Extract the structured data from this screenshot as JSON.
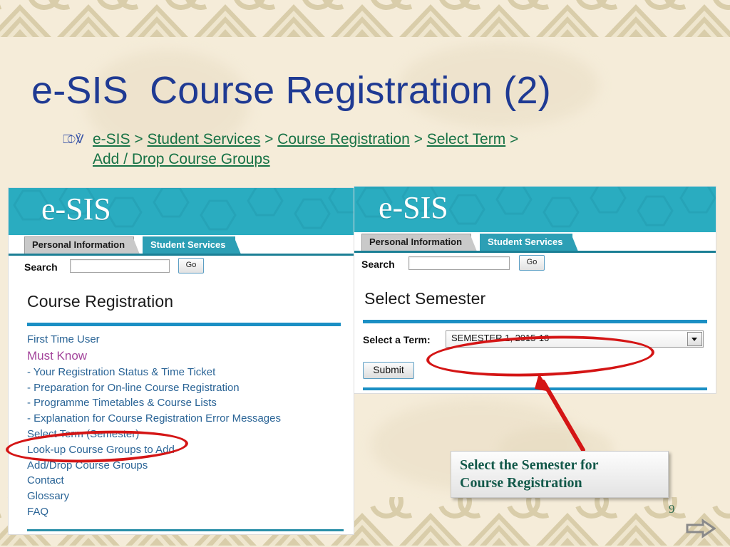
{
  "slide": {
    "title_part1": "e-SIS",
    "title_part2": "Course Registration (2)",
    "page_number": "9",
    "accent_navy": "#1f3a93",
    "accent_teal": "#2aacc0",
    "accent_green": "#177245",
    "annotation_red": "#d41515",
    "background": "#f5ecd9"
  },
  "breadcrumb": {
    "bullet_icon": "fleuron-icon",
    "items": [
      "e-SIS",
      "Student Services",
      "Course Registration",
      "Select Term",
      "Add / Drop Course Groups"
    ],
    "separator": ">"
  },
  "left_panel": {
    "logo": "e-SIS",
    "tabs": [
      {
        "label": "Personal Information",
        "active": false
      },
      {
        "label": "Student Services",
        "active": true
      }
    ],
    "search": {
      "label": "Search",
      "value": "",
      "placeholder": "",
      "button": "Go"
    },
    "heading": "Course Registration",
    "links": [
      {
        "text": "First Time User",
        "style": "link"
      },
      {
        "text": "Must Know",
        "style": "mustknow"
      },
      {
        "text": "- Your Registration Status & Time Ticket",
        "style": "link"
      },
      {
        "text": "- Preparation for On-line Course Registration",
        "style": "link"
      },
      {
        "text": "- Programme Timetables & Course Lists",
        "style": "link"
      },
      {
        "text": "- Explanation for Course Registration Error Messages",
        "style": "link"
      },
      {
        "text": "Select Term (Semester)",
        "style": "link"
      },
      {
        "text": "Look-up Course Groups to Add",
        "style": "link"
      },
      {
        "text": "Add/Drop Course Groups",
        "style": "link"
      },
      {
        "text": "Contact",
        "style": "link"
      },
      {
        "text": "Glossary",
        "style": "link"
      },
      {
        "text": "FAQ",
        "style": "link"
      }
    ]
  },
  "right_panel": {
    "logo": "e-SIS",
    "tabs": [
      {
        "label": "Personal Information",
        "active": false
      },
      {
        "label": "Student Services",
        "active": true
      }
    ],
    "search": {
      "label": "Search",
      "value": "",
      "placeholder": "",
      "button": "Go"
    },
    "heading": "Select Semester",
    "term_label": "Select a Term:",
    "term_value": "SEMESTER 1, 2015-16",
    "submit_label": "Submit"
  },
  "callout": {
    "line1": "Select the Semester for",
    "line2": "Course Registration"
  }
}
